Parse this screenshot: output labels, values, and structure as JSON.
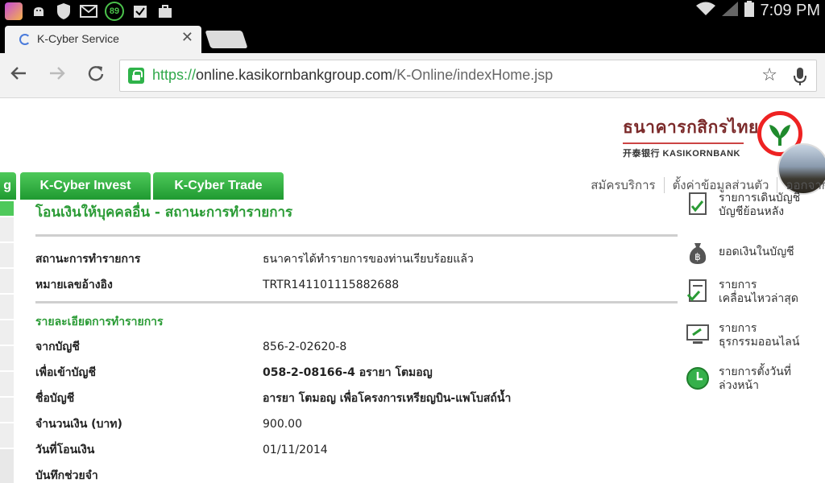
{
  "status_bar": {
    "clock": "7:09 PM",
    "battery_badge": "89",
    "icons": [
      "app-icon",
      "android-icon",
      "shield-icon",
      "mail-icon",
      "battery-saver-icon",
      "check-box-icon",
      "briefcase-icon",
      "wifi-icon",
      "signal-icon",
      "battery-icon"
    ]
  },
  "browser": {
    "tab_title": "K-Cyber Service",
    "url_scheme": "https://",
    "url_host": "online.kasikornbankgroup.com",
    "url_path": "/K-Online/indexHome.jsp"
  },
  "header": {
    "logo_thai": "ธนาคารกสิกรไทย",
    "logo_en": "开泰银行 KASIKORNBANK",
    "tabs": [
      {
        "label": "g"
      },
      {
        "label": "K-Cyber Invest"
      },
      {
        "label": "K-Cyber Trade"
      }
    ],
    "links": [
      "สมัครบริการ",
      "ตั้งค่าข้อมูลส่วนตัว",
      "ออกจากระบบ"
    ]
  },
  "main": {
    "title": "โอนเงินให้บุคคลอื่น - สถานะการทำรายการ",
    "status_rows": [
      {
        "label": "สถานะการทำรายการ",
        "value": "ธนาคารได้ทำรายการของท่านเรียบร้อยแล้ว"
      },
      {
        "label": "หมายเลขอ้างอิง",
        "value": "TRTR141101115882688"
      }
    ],
    "details_heading": "รายละเอียดการทำรายการ",
    "detail_rows": [
      {
        "label": "จากบัญชี",
        "value": "856-2-02620-8"
      },
      {
        "label": "เพื่อเข้าบัญชี",
        "value": "058-2-08166-4 อรายา โตมอญ"
      },
      {
        "label": "ชื่อบัญชี",
        "value": "อารยา โตมอญ เพื่อโครงการเหรียญบิน-แพโบสถ์น้ำ"
      },
      {
        "label": "จำนวนเงิน (บาท)",
        "value": "900.00"
      },
      {
        "label": "วันที่โอนเงิน",
        "value": "01/11/2014"
      },
      {
        "label": "บันทึกช่วยจำ",
        "value": ""
      }
    ]
  },
  "right_menu": [
    {
      "line1": "รายการเดินบัญชี",
      "line2": "บัญชีย้อนหลัง",
      "icon": "statement-icon"
    },
    {
      "line1": "ยอดเงินในบัญชี",
      "line2": "",
      "icon": "money-bag-icon"
    },
    {
      "line1": "รายการ",
      "line2": "เคลื่อนไหวล่าสุด",
      "icon": "checklist-icon"
    },
    {
      "line1": "รายการ",
      "line2": "ธุรกรรมออนไลน์",
      "icon": "monitor-icon"
    },
    {
      "line1": "รายการตั้งวันที่",
      "line2": "ล่วงหน้า",
      "icon": "clock-icon"
    }
  ],
  "colors": {
    "accent_green": "#2a9b35",
    "tab_green": "#1f9a31",
    "logo_red": "#e22222"
  }
}
